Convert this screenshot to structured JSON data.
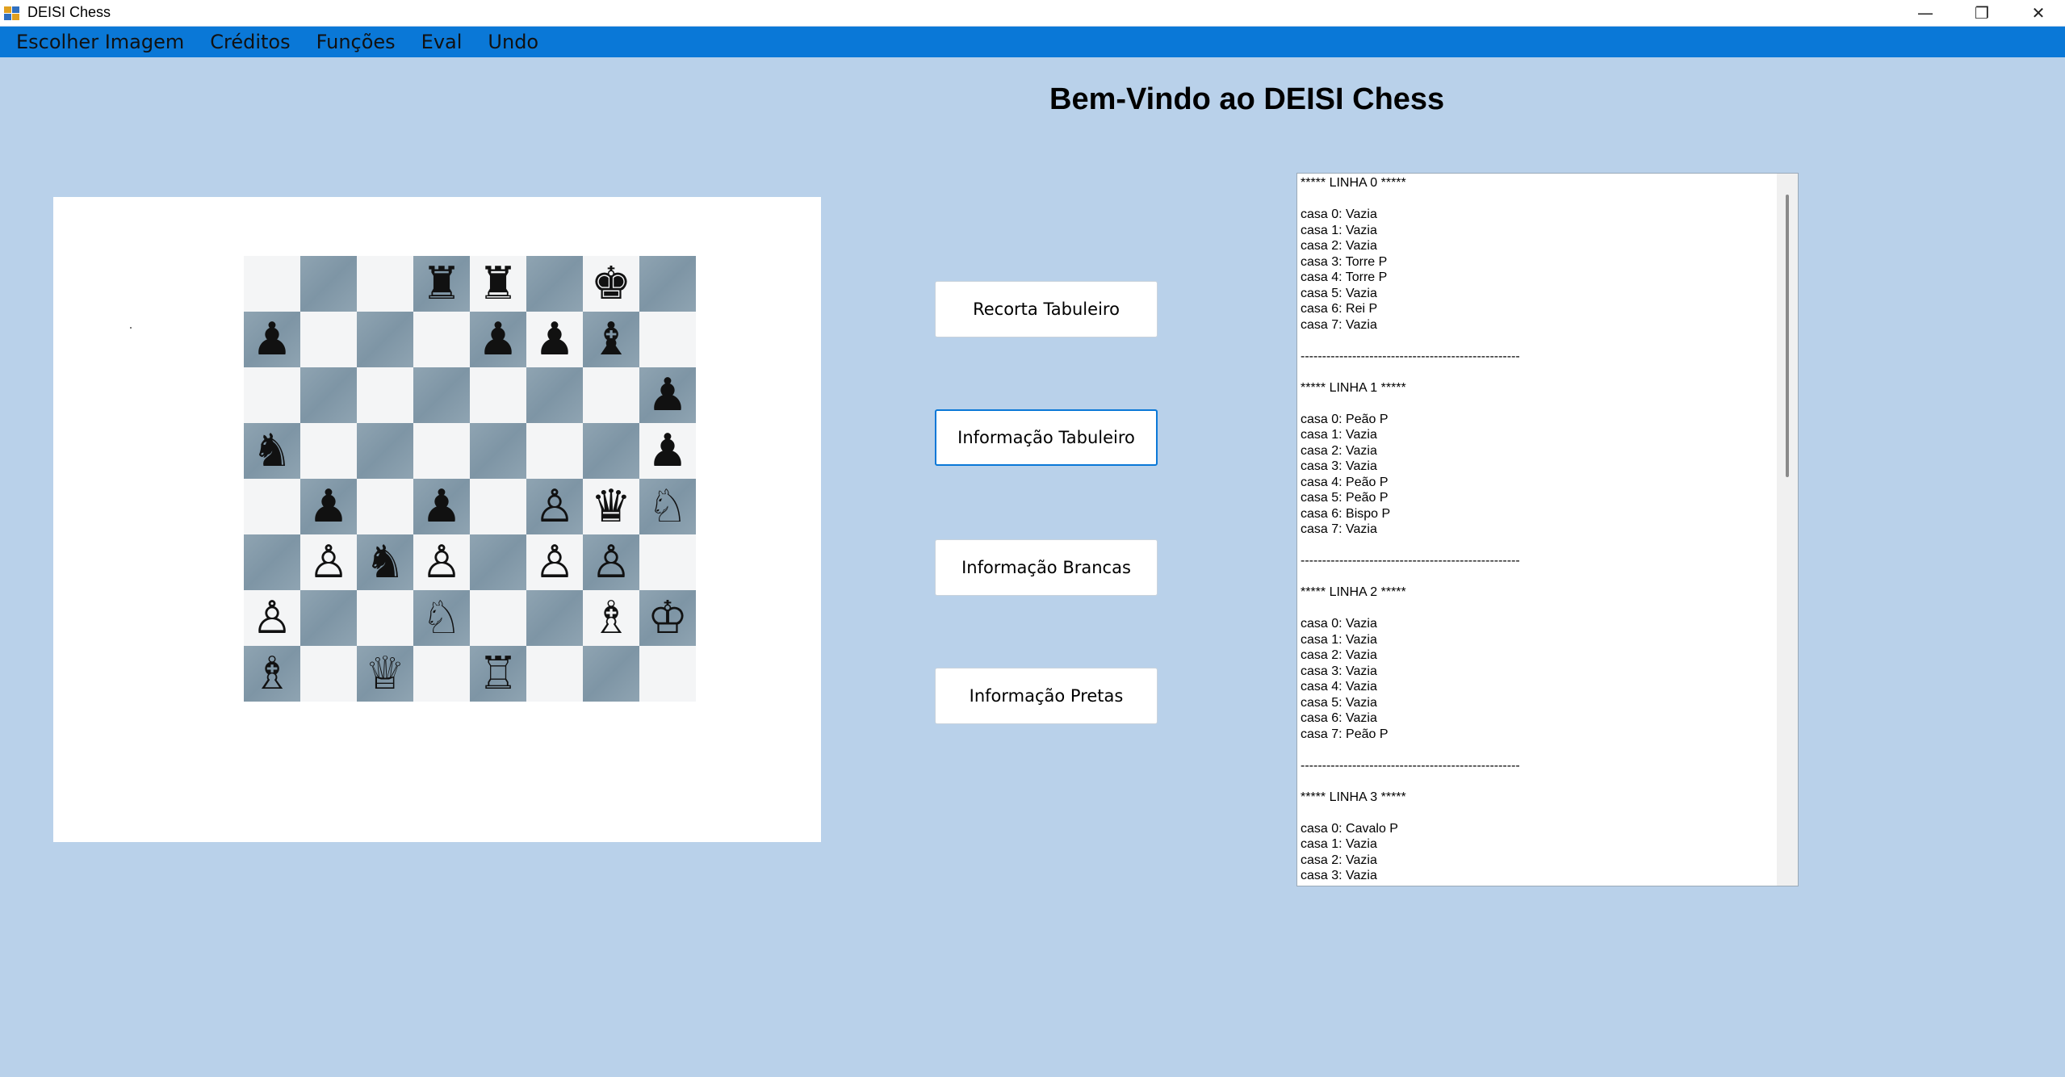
{
  "window": {
    "title": "DEISI Chess",
    "minimize_glyph": "—",
    "maximize_glyph": "❐",
    "close_glyph": "✕"
  },
  "menu": [
    "Escolher Imagem",
    "Créditos",
    "Funções",
    "Eval",
    "Undo"
  ],
  "heading": "Bem-Vindo ao DEISI Chess",
  "buttons": {
    "recorta": "Recorta Tabuleiro",
    "info_tabuleiro": "Informação Tabuleiro",
    "info_brancas": "Informação Brancas",
    "info_pretas": "Informação Pretas"
  },
  "board": [
    [
      "",
      "",
      "",
      "♜",
      "♜",
      "",
      "♚",
      ""
    ],
    [
      "♟",
      "",
      "",
      "",
      "♟",
      "♟",
      "♝",
      ""
    ],
    [
      "",
      "",
      "",
      "",
      "",
      "",
      "",
      "♟"
    ],
    [
      "♞",
      "",
      "",
      "",
      "",
      "",
      "",
      "♟"
    ],
    [
      "",
      "♟",
      "",
      "♟",
      "",
      "♙",
      "♛",
      "♘"
    ],
    [
      "",
      "♙",
      "♞",
      "♙",
      "",
      "♙",
      "♙",
      ""
    ],
    [
      "♙",
      "",
      "",
      "♘",
      "",
      "",
      "♗",
      "♔"
    ],
    [
      "♗",
      "",
      "♕",
      "",
      "♖",
      "",
      "",
      ""
    ]
  ],
  "board_info_text": "***** LINHA 0 *****\n\ncasa 0: Vazia\ncasa 1: Vazia\ncasa 2: Vazia\ncasa 3: Torre P\ncasa 4: Torre P\ncasa 5: Vazia\ncasa 6: Rei P\ncasa 7: Vazia\n\n---------------------------------------------------\n\n***** LINHA 1 *****\n\ncasa 0: Peão P\ncasa 1: Vazia\ncasa 2: Vazia\ncasa 3: Vazia\ncasa 4: Peão P\ncasa 5: Peão P\ncasa 6: Bispo P\ncasa 7: Vazia\n\n---------------------------------------------------\n\n***** LINHA 2 *****\n\ncasa 0: Vazia\ncasa 1: Vazia\ncasa 2: Vazia\ncasa 3: Vazia\ncasa 4: Vazia\ncasa 5: Vazia\ncasa 6: Vazia\ncasa 7: Peão P\n\n---------------------------------------------------\n\n***** LINHA 3 *****\n\ncasa 0: Cavalo P\ncasa 1: Vazia\ncasa 2: Vazia\ncasa 3: Vazia"
}
